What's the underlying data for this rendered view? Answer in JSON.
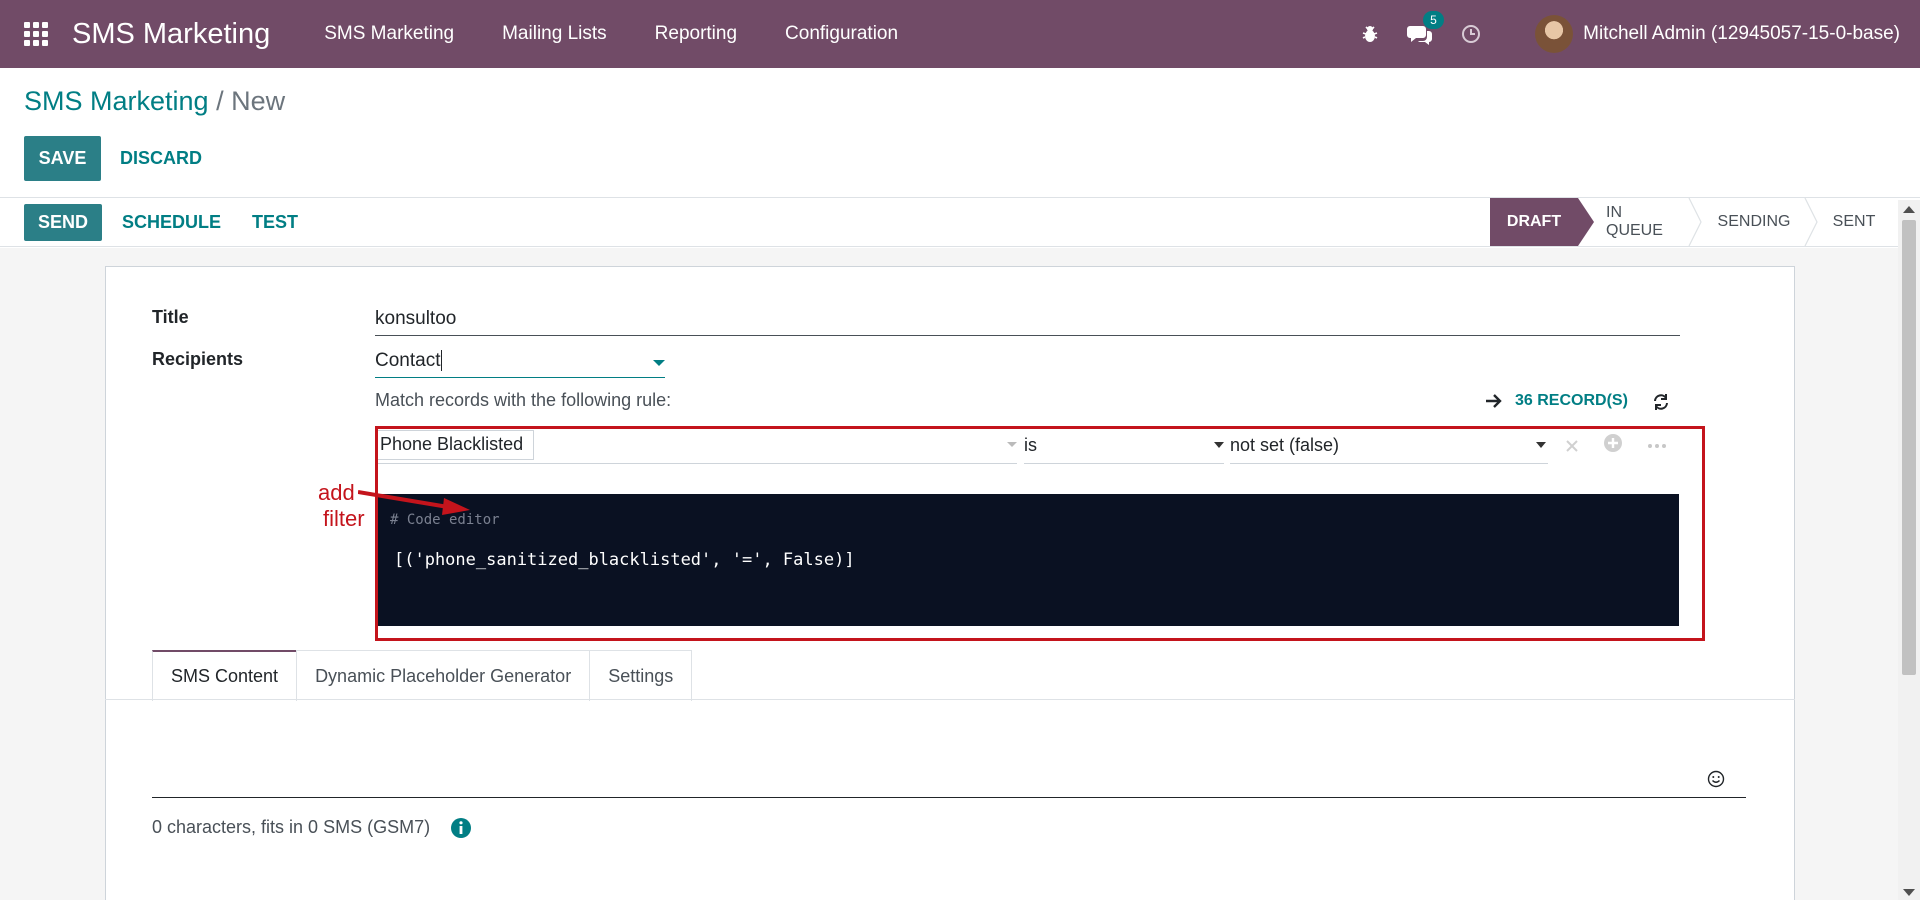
{
  "navbar": {
    "brand": "SMS Marketing",
    "menu": [
      "SMS Marketing",
      "Mailing Lists",
      "Reporting",
      "Configuration"
    ],
    "messages_badge": "5",
    "user": "Mitchell Admin (12945057-15-0-base)"
  },
  "breadcrumb": {
    "parent": "SMS Marketing",
    "separator": "/",
    "current": "New"
  },
  "actions": {
    "save": "SAVE",
    "discard": "DISCARD"
  },
  "statusbar": {
    "send": "SEND",
    "schedule": "SCHEDULE",
    "test": "TEST",
    "stages": [
      "DRAFT",
      "IN QUEUE",
      "SENDING",
      "SENT"
    ],
    "active_stage": "DRAFT"
  },
  "form": {
    "title_label": "Title",
    "title_value": "konsultoo",
    "recipients_label": "Recipients",
    "recipients_value": "Contact",
    "match_text": "Match records with the following rule:",
    "records": "36 RECORD(S)",
    "rule": {
      "field": "Phone Blacklisted",
      "operator": "is",
      "value": "not set (false)"
    },
    "code_comment": "# Code editor",
    "code": "[('phone_sanitized_blacklisted', '=', False)]"
  },
  "annotation": {
    "line1": "add",
    "line2": "filter",
    "color": "#c4141c"
  },
  "tabs": [
    "SMS Content",
    "Dynamic Placeholder Generator",
    "Settings"
  ],
  "sms": {
    "char_count": "0 characters, fits in 0 SMS (GSM7)"
  },
  "colors": {
    "primary": "#714b67",
    "accent": "#017e84"
  }
}
